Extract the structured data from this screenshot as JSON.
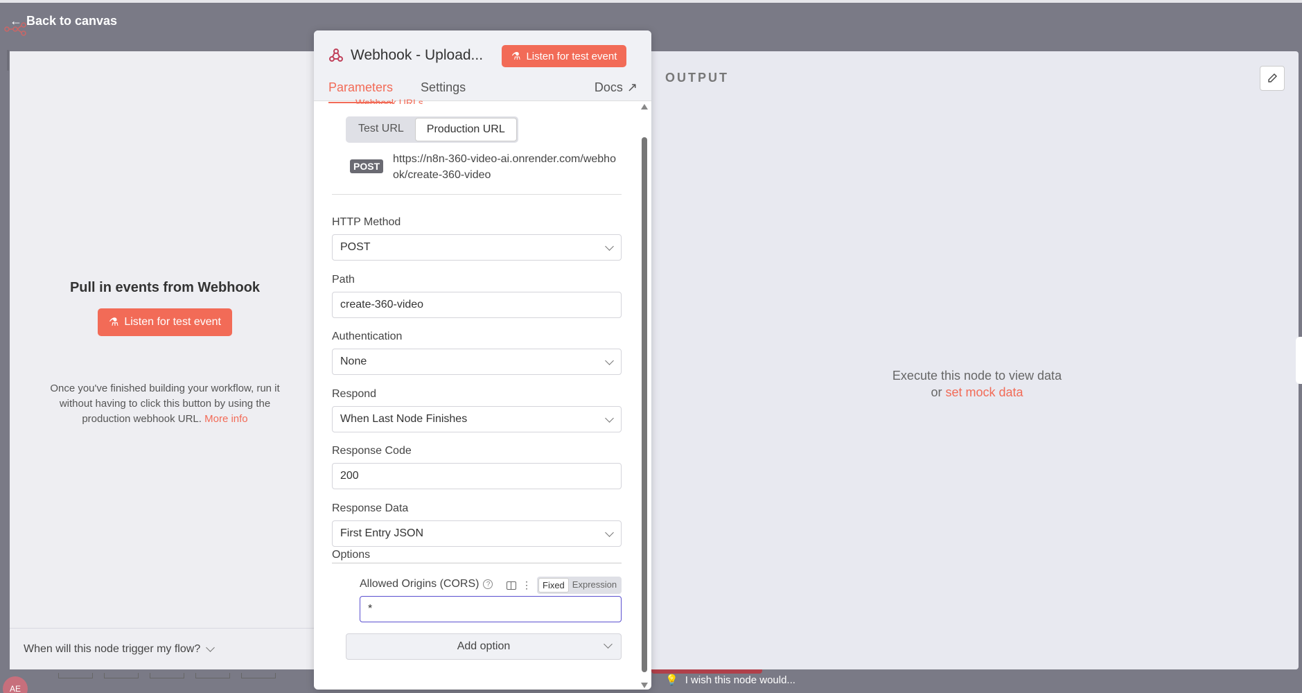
{
  "nav": {
    "back_label": "Back to canvas"
  },
  "user": {
    "avatar_initials": "AE"
  },
  "input_pane": {
    "title": "Pull in events from Webhook",
    "listen_label": "Listen for test event",
    "description": "Once you've finished building your workflow, run it without having to click this button by using the production webhook URL.",
    "more_info": "More info",
    "trigger_question": "When will this node trigger my flow?"
  },
  "panel": {
    "title": "Webhook - Upload...",
    "listen_label": "Listen for test event",
    "tabs": [
      "Parameters",
      "Settings"
    ],
    "active_tab": "Parameters",
    "docs_label": "Docs",
    "webhook_urls_label": "Webhook URLs",
    "url_toggle": {
      "test": "Test URL",
      "production": "Production URL",
      "selected": "Production URL"
    },
    "method_badge": "POST",
    "webhook_url": "https://n8n-360-video-ai.onrender.com/webhook/create-360-video",
    "fields": {
      "http_method": {
        "label": "HTTP Method",
        "value": "POST"
      },
      "path": {
        "label": "Path",
        "value": "create-360-video"
      },
      "authentication": {
        "label": "Authentication",
        "value": "None"
      },
      "respond": {
        "label": "Respond",
        "value": "When Last Node Finishes"
      },
      "response_code": {
        "label": "Response Code",
        "value": "200"
      },
      "response_data": {
        "label": "Response Data",
        "value": "First Entry JSON"
      }
    },
    "options_label": "Options",
    "cors": {
      "label": "Allowed Origins (CORS)",
      "value": "*",
      "mode_fixed": "Fixed",
      "mode_expression": "Expression",
      "selected_mode": "Fixed"
    },
    "add_option_label": "Add option"
  },
  "output_pane": {
    "label": "OUTPUT",
    "empty_message": "Execute this node to view data",
    "or_text": "or",
    "mock_link": "set mock data"
  },
  "footer": {
    "wish_text": "I wish this node would..."
  },
  "colors": {
    "accent": "#f26b57",
    "focus": "#5a4fcf"
  }
}
